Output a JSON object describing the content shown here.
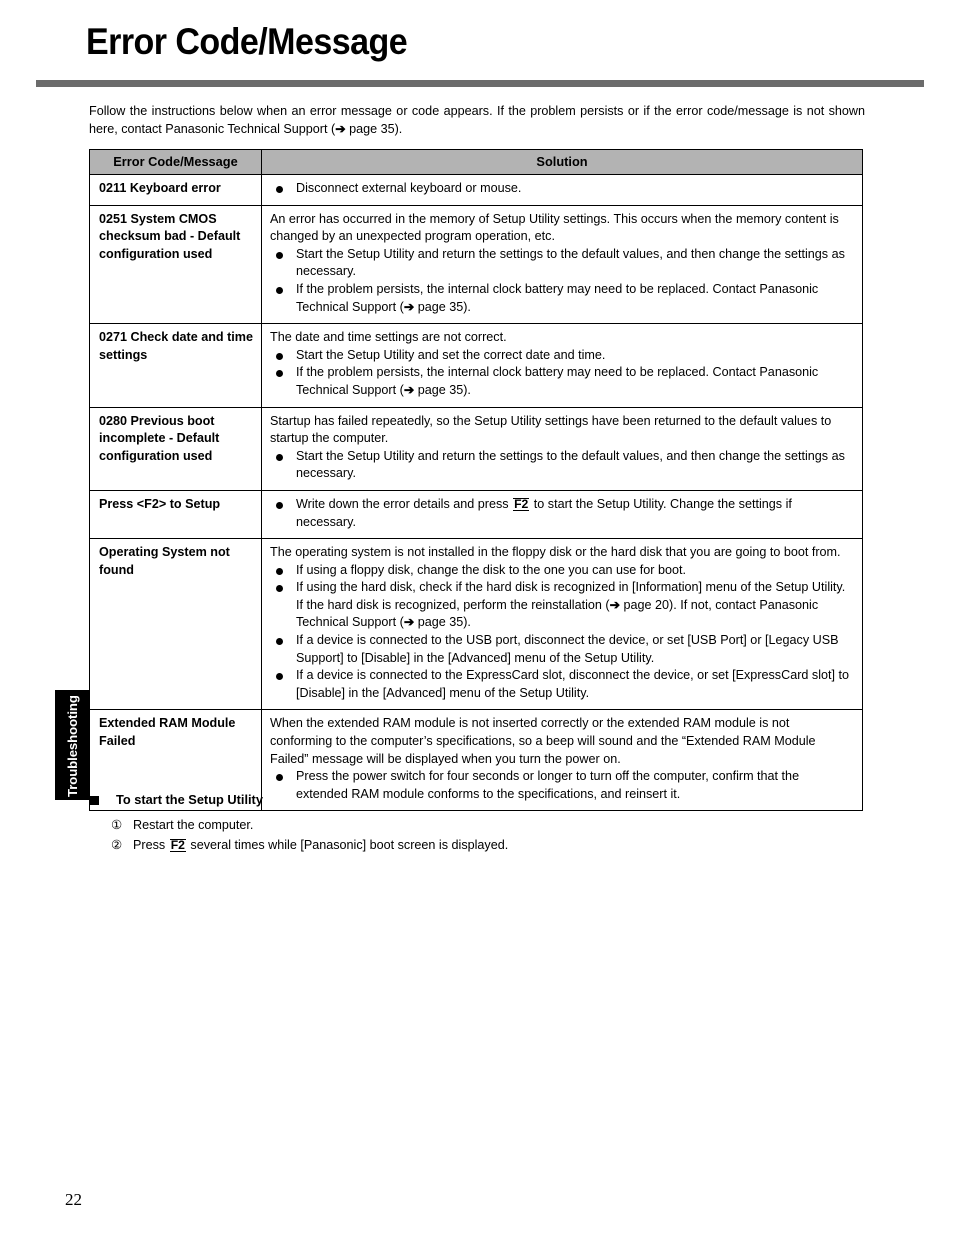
{
  "page": {
    "title": "Error Code/Message",
    "number": "22",
    "side_tab": "Troubleshooting",
    "intro": "Follow the instructions below when an error message or code appears. If the problem persists or if the error code/message is not shown here, contact Panasonic Technical Support (➔ page 35)."
  },
  "table": {
    "headers": {
      "code": "Error Code/Message",
      "solution": "Solution"
    },
    "rows": [
      {
        "code": "0211 Keyboard error",
        "intro_lines": [],
        "bullets": [
          "Disconnect external keyboard or mouse."
        ]
      },
      {
        "code": "0251 System CMOS checksum bad - Default configuration used",
        "intro_lines": [
          "An error has occurred in the memory of Setup Utility settings. This occurs when the memory content is changed by an unexpected program operation, etc."
        ],
        "bullets": [
          "Start the Setup Utility and return the settings to the default values, and then change the settings as necessary.",
          "If the problem persists, the internal clock battery may need to be replaced. Contact Panasonic Technical Support (➔ page 35)."
        ]
      },
      {
        "code": "0271 Check date and time settings",
        "intro_lines": [
          "The date and time settings are not correct."
        ],
        "bullets": [
          "Start the Setup Utility and set the correct date and time.",
          "If the problem persists, the internal clock battery may need to be replaced. Contact Panasonic Technical Support (➔ page 35)."
        ]
      },
      {
        "code": "0280 Previous boot incomplete - Default configuration used",
        "intro_lines": [
          "Startup has failed repeatedly, so the Setup Utility settings have been returned to the default values to startup the computer."
        ],
        "bullets": [
          "Start the Setup Utility and return the settings to the default values, and then change the settings as necessary."
        ]
      },
      {
        "code": "Press <F2> to Setup",
        "intro_lines": [],
        "bullets": [
          "Write down the error details and press ⌨F2 to start the Setup Utility. Change the settings if necessary."
        ]
      },
      {
        "code": "Operating System not found",
        "intro_lines": [
          "The operating system is not installed in the floppy disk or the hard disk that you are going to boot from."
        ],
        "bullets": [
          "If using a floppy disk, change the disk to the one you can use for boot.",
          "If using the hard disk, check if the hard disk is recognized in [Information] menu of the Setup Utility. If the hard disk is recognized, perform the reinstallation (➔ page 20). If not, contact Panasonic Technical Support (➔ page 35).",
          "If a device is connected to the USB port, disconnect the device, or set [USB Port] or [Legacy USB Support] to [Disable] in the [Advanced] menu of the Setup Utility.",
          "If a device is connected to the ExpressCard slot, disconnect the device, or set [ExpressCard slot] to [Disable] in the [Advanced] menu of the Setup Utility."
        ]
      },
      {
        "code": "Extended RAM Module Failed",
        "intro_lines": [
          "When the extended RAM module is not inserted correctly or the extended RAM module is not conforming to the computer’s specifications, so a beep will sound and the “Extended RAM Module Failed” message will be displayed when you turn the power on."
        ],
        "bullets": [
          "Press the power switch for four seconds or longer to turn off the computer, confirm that the extended RAM module conforms to the specifications, and reinsert it."
        ]
      }
    ]
  },
  "note": {
    "heading": "To start the Setup Utility",
    "steps": [
      {
        "marker": "①",
        "text": "Restart the computer."
      },
      {
        "marker": "②",
        "text_before": "Press ",
        "key": "F2",
        "text_after": " several times while [Panasonic] boot screen is displayed."
      }
    ]
  },
  "colors": {
    "rule": "#6b6b6b",
    "table_header_bg": "#b3b3b3",
    "tab_bg": "#000000",
    "text": "#000000"
  }
}
